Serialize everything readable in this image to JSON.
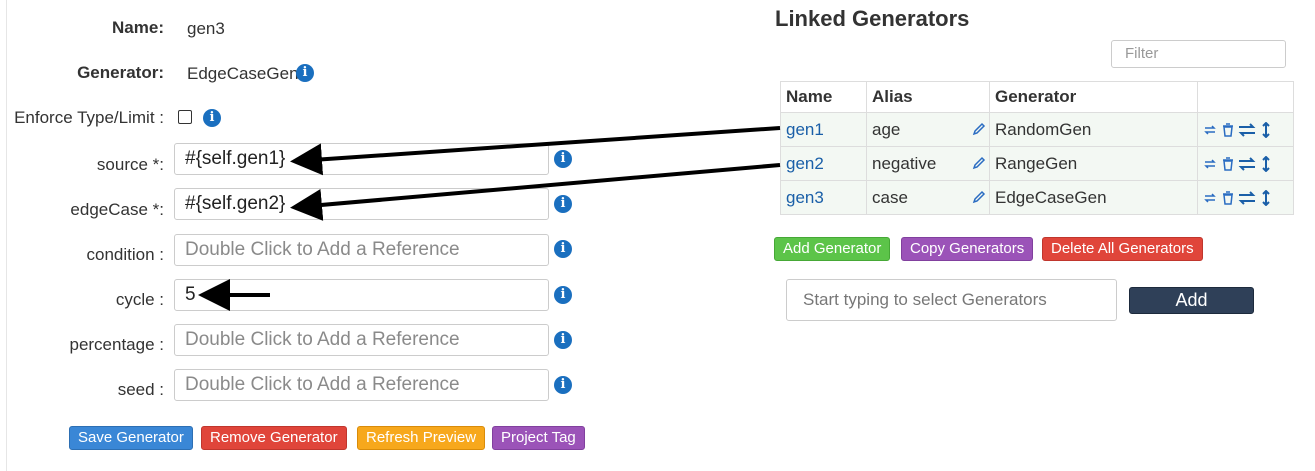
{
  "form": {
    "name_label": "Name:",
    "name_value": "gen3",
    "generator_label": "Generator:",
    "generator_value": "EdgeCaseGen",
    "enforce_label": "Enforce Type/Limit :",
    "enforce_checked": false,
    "fields": [
      {
        "label": "source *:",
        "value": "#{self.gen1}",
        "placeholder": ""
      },
      {
        "label": "edgeCase *:",
        "value": "#{self.gen2}",
        "placeholder": ""
      },
      {
        "label": "condition :",
        "value": "",
        "placeholder": "Double Click to Add a Reference"
      },
      {
        "label": "cycle :",
        "value": "5",
        "placeholder": ""
      },
      {
        "label": "percentage :",
        "value": "",
        "placeholder": "Double Click to Add a Reference"
      },
      {
        "label": "seed :",
        "value": "",
        "placeholder": "Double Click to Add a Reference"
      }
    ],
    "buttons": {
      "save": "Save Generator",
      "remove": "Remove Generator",
      "refresh": "Refresh Preview",
      "tag": "Project Tag"
    }
  },
  "linked": {
    "title": "Linked Generators",
    "filter_placeholder": "Filter",
    "columns": [
      "Name",
      "Alias",
      "Generator",
      ""
    ],
    "rows": [
      {
        "name": "gen1",
        "alias": "age",
        "generator": "RandomGen"
      },
      {
        "name": "gen2",
        "alias": "negative",
        "generator": "RangeGen"
      },
      {
        "name": "gen3",
        "alias": "case",
        "generator": "EdgeCaseGen"
      }
    ],
    "buttons": {
      "add_generator": "Add Generator",
      "copy_generators": "Copy Generators",
      "delete_all": "Delete All Generators"
    },
    "search_placeholder": "Start typing to select Generators",
    "add_label": "Add"
  },
  "colors": {
    "link": "#1a5fa8",
    "info": "#1a6fbf",
    "save": "#3a87d6",
    "remove": "#e0453a",
    "refresh": "#f7a81c",
    "tag": "#9b53b8",
    "add_generator": "#5cc449",
    "add_button": "#2f4058"
  }
}
